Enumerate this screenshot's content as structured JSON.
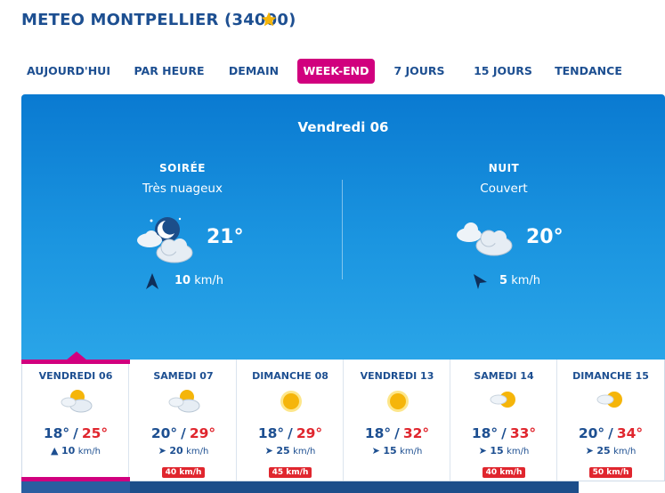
{
  "header": {
    "title": "METEO MONTPELLIER (34000)"
  },
  "tabs": [
    {
      "label": "AUJOURD'HUI",
      "active": false
    },
    {
      "label": "PAR HEURE",
      "active": false
    },
    {
      "label": "DEMAIN",
      "active": false
    },
    {
      "label": "WEEK-END",
      "active": true
    },
    {
      "label": "7 JOURS",
      "active": false
    },
    {
      "label": "15 JOURS",
      "active": false
    },
    {
      "label": "TENDANCE",
      "active": false
    }
  ],
  "detail": {
    "day": "Vendredi 06",
    "periods": [
      {
        "label": "SOIRÉE",
        "condition": "Très nuageux",
        "temp": "21°",
        "wind_speed": "10",
        "wind_unit": "km/h",
        "icon": "night-cloudy-icon"
      },
      {
        "label": "NUIT",
        "condition": "Couvert",
        "temp": "20°",
        "wind_speed": "5",
        "wind_unit": "km/h",
        "icon": "overcast-icon"
      }
    ]
  },
  "days": [
    {
      "name": "VENDREDI 06",
      "tmin": "18°",
      "tmax": "25°",
      "wind": "10",
      "unit": "km/h",
      "gust": "",
      "icon": "sun-cloud-icon"
    },
    {
      "name": "SAMEDI 07",
      "tmin": "20°",
      "tmax": "29°",
      "wind": "20",
      "unit": "km/h",
      "gust": "40 km/h",
      "icon": "sun-cloud-icon"
    },
    {
      "name": "DIMANCHE 08",
      "tmin": "18°",
      "tmax": "29°",
      "wind": "25",
      "unit": "km/h",
      "gust": "45 km/h",
      "icon": "sun-icon"
    },
    {
      "name": "VENDREDI 13",
      "tmin": "18°",
      "tmax": "32°",
      "wind": "15",
      "unit": "km/h",
      "gust": "",
      "icon": "sun-icon"
    },
    {
      "name": "SAMEDI 14",
      "tmin": "18°",
      "tmax": "33°",
      "wind": "15",
      "unit": "km/h",
      "gust": "40 km/h",
      "icon": "sun-haze-icon"
    },
    {
      "name": "DIMANCHE 15",
      "tmin": "20°",
      "tmax": "34°",
      "wind": "25",
      "unit": "km/h",
      "gust": "50 km/h",
      "icon": "sun-haze-icon"
    }
  ],
  "colors": {
    "brand": "#1d4f91",
    "accent": "#d1007e",
    "hot": "#e0262e",
    "panel": "#1b95e0"
  }
}
